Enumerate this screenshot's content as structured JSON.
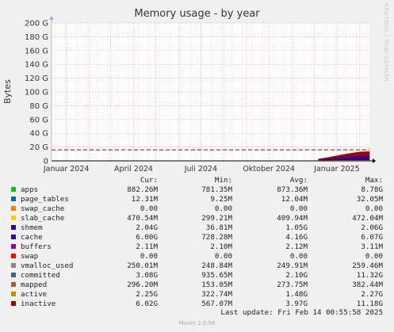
{
  "title": "Memory usage - by year",
  "ylabel": "Bytes",
  "watermark": "RRDTOOL / TOBI OETIKER",
  "legend_header": {
    "cur": "Cur:",
    "min": "Min:",
    "avg": "Avg:",
    "max": "Max:"
  },
  "legend": [
    {
      "name": "apps",
      "color": "#00cc00",
      "cur": "882.26M",
      "min": "781.35M",
      "avg": "873.36M",
      "max": "8.78G"
    },
    {
      "name": "page_tables",
      "color": "#0066b3",
      "cur": "12.31M",
      "min": "9.25M",
      "avg": "12.04M",
      "max": "32.05M"
    },
    {
      "name": "swap_cache",
      "color": "#ff8000",
      "cur": "0.00",
      "min": "0.00",
      "avg": "0.00",
      "max": "0.00"
    },
    {
      "name": "slab_cache",
      "color": "#ffcc00",
      "cur": "470.54M",
      "min": "299.21M",
      "avg": "409.94M",
      "max": "472.04M"
    },
    {
      "name": "shmem",
      "color": "#330099",
      "cur": "2.04G",
      "min": "36.81M",
      "avg": "1.05G",
      "max": "2.06G"
    },
    {
      "name": "cache",
      "color": "#330099",
      "cur": "6.00G",
      "min": "728.28M",
      "avg": "4.16G",
      "max": "6.07G"
    },
    {
      "name": "buffers",
      "color": "#990099",
      "cur": "2.11M",
      "min": "2.10M",
      "avg": "2.12M",
      "max": "3.11M"
    },
    {
      "name": "swap",
      "color": "#ff0000",
      "cur": "0.00",
      "min": "0.00",
      "avg": "0.00",
      "max": "0.00"
    },
    {
      "name": "vmalloc_used",
      "color": "#888888",
      "cur": "250.01M",
      "min": "248.84M",
      "avg": "249.91M",
      "max": "259.46M"
    },
    {
      "name": "committed",
      "color": "#336699",
      "cur": "3.08G",
      "min": "935.65M",
      "avg": "2.10G",
      "max": "11.32G"
    },
    {
      "name": "mapped",
      "color": "#b35a2d",
      "cur": "296.20M",
      "min": "153.05M",
      "avg": "273.75M",
      "max": "382.44M"
    },
    {
      "name": "active",
      "color": "#b39600",
      "cur": "2.25G",
      "min": "322.74M",
      "avg": "1.48G",
      "max": "2.27G"
    },
    {
      "name": "inactive",
      "color": "#a00000",
      "cur": "6.02G",
      "min": "567.07M",
      "avg": "3.97G",
      "max": "11.18G"
    }
  ],
  "last_update": "Last update: Fri Feb 14 00:55:58 2025",
  "footer": "Munin 2.0.56",
  "chart_data": {
    "type": "area",
    "title": "Memory usage - by year",
    "ylabel": "Bytes",
    "xlabel": "",
    "ylim": [
      0,
      200
    ],
    "y_unit": "G",
    "yticks": [
      {
        "value": 0,
        "label": "0"
      },
      {
        "value": 20,
        "label": "20 G"
      },
      {
        "value": 40,
        "label": "40 G"
      },
      {
        "value": 60,
        "label": "60 G"
      },
      {
        "value": 80,
        "label": "80 G"
      },
      {
        "value": 100,
        "label": "100 G"
      },
      {
        "value": 120,
        "label": "120 G"
      },
      {
        "value": 140,
        "label": "140 G"
      },
      {
        "value": 160,
        "label": "160 G"
      },
      {
        "value": 180,
        "label": "180 G"
      },
      {
        "value": 200,
        "label": "200 G"
      }
    ],
    "xlim": [
      "2023-12-12",
      "2025-02-14"
    ],
    "xticks": [
      {
        "date": "2024-01-01",
        "label": "Januar 2024"
      },
      {
        "date": "2024-04-01",
        "label": "April 2024"
      },
      {
        "date": "2024-07-01",
        "label": "Juli 2024"
      },
      {
        "date": "2024-10-01",
        "label": "Oktober 2024"
      },
      {
        "date": "2025-01-01",
        "label": "Januar 2025"
      }
    ],
    "grid": true,
    "threshold_line": {
      "value": 16,
      "color": "#a00000",
      "style": "dashed"
    },
    "series": [
      {
        "name": "apps",
        "color": "#00cc00",
        "x": [
          "2024-12-07",
          "2024-12-21",
          "2025-01-04",
          "2025-01-18",
          "2025-02-01",
          "2025-02-14"
        ],
        "values": [
          0.9,
          0.9,
          0.9,
          0.9,
          0.9,
          0.88
        ]
      },
      {
        "name": "slab_cache",
        "color": "#ffcc00",
        "x": [
          "2024-12-07",
          "2024-12-21",
          "2025-01-04",
          "2025-01-18",
          "2025-02-01",
          "2025-02-14"
        ],
        "values": [
          0.3,
          0.35,
          0.4,
          0.42,
          0.45,
          0.47
        ]
      },
      {
        "name": "cache",
        "color": "#330099",
        "x": [
          "2024-12-07",
          "2024-12-21",
          "2025-01-04",
          "2025-01-18",
          "2025-02-01",
          "2025-02-14"
        ],
        "values": [
          0.7,
          2.0,
          3.5,
          4.8,
          5.8,
          6.0
        ]
      },
      {
        "name": "inactive",
        "color": "#a00000",
        "x": [
          "2024-12-07",
          "2024-12-21",
          "2025-01-04",
          "2025-01-18",
          "2025-02-01",
          "2025-02-14"
        ],
        "values": [
          0.6,
          1.8,
          3.2,
          4.5,
          5.7,
          6.02
        ]
      }
    ]
  }
}
